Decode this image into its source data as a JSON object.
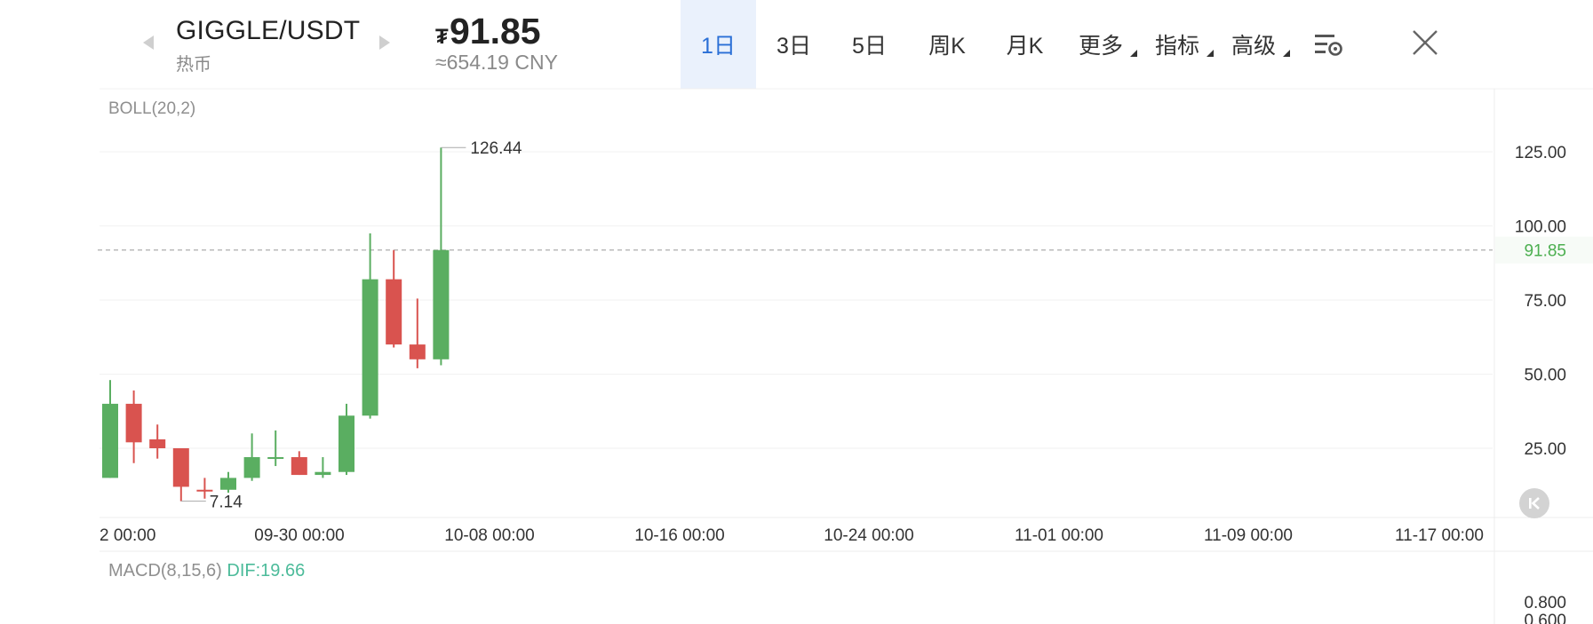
{
  "header": {
    "pair": "GIGGLE/USDT",
    "tag": "热币",
    "price_symbol": "₮",
    "price": "91.85",
    "price_cny": "≈654.19 CNY"
  },
  "tabs": [
    {
      "label": "1日",
      "active": true
    },
    {
      "label": "3日"
    },
    {
      "label": "5日"
    },
    {
      "label": "周K"
    },
    {
      "label": "月K"
    },
    {
      "label": "更多",
      "dropdown": true
    },
    {
      "label": "指标",
      "dropdown": true
    },
    {
      "label": "高级",
      "dropdown": true
    }
  ],
  "icons": {
    "settings": "chart-settings-icon",
    "close": "close-icon",
    "rewind": "rewind-to-latest-icon"
  },
  "colors": {
    "up": "#5aae61",
    "down": "#d9534f",
    "last_price": "#4caf50",
    "dif": "#4cbb9a",
    "active_tab": "#2a6fd6"
  },
  "indicator_label": "BOLL(20,2)",
  "macd": {
    "label": "MACD(8,15,6)",
    "dif": "DIF:19.66",
    "ticks": [
      "0.800",
      "0.600"
    ]
  },
  "chart_data": {
    "type": "candlestick",
    "interval": "1日",
    "ylim": [
      0,
      135
    ],
    "y_ticks": [
      "125.00",
      "100.00",
      "75.00",
      "50.00",
      "25.00"
    ],
    "y_tick_values": [
      125,
      100,
      75,
      50,
      25
    ],
    "x_tick_labels": [
      "2 00:00",
      "09-30 00:00",
      "10-08 00:00",
      "10-16 00:00",
      "10-24 00:00",
      "11-01 00:00",
      "11-09 00:00",
      "11-17 00:00"
    ],
    "last_price": 91.85,
    "last_price_label": "91.85",
    "max_label": "126.44",
    "min_label": "7.14",
    "candles": [
      {
        "open": 15,
        "high": 48,
        "low": 15,
        "close": 40
      },
      {
        "open": 40,
        "high": 44.5,
        "low": 20,
        "close": 27
      },
      {
        "open": 28,
        "high": 33,
        "low": 21.5,
        "close": 25
      },
      {
        "open": 25,
        "high": 25,
        "low": 7.14,
        "close": 12
      },
      {
        "open": 11,
        "high": 15,
        "low": 8,
        "close": 10.5
      },
      {
        "open": 11,
        "high": 17,
        "low": 10,
        "close": 15
      },
      {
        "open": 15,
        "high": 30,
        "low": 14,
        "close": 22
      },
      {
        "open": 22,
        "high": 31,
        "low": 19,
        "close": 22
      },
      {
        "open": 22,
        "high": 24,
        "low": 16,
        "close": 16
      },
      {
        "open": 16,
        "high": 22,
        "low": 15,
        "close": 17
      },
      {
        "open": 17,
        "high": 40,
        "low": 16,
        "close": 36
      },
      {
        "open": 36,
        "high": 97.5,
        "low": 35,
        "close": 82
      },
      {
        "open": 82,
        "high": 91.85,
        "low": 59,
        "close": 60
      },
      {
        "open": 60,
        "high": 75.5,
        "low": 52,
        "close": 55
      },
      {
        "open": 55,
        "high": 126.44,
        "low": 53,
        "close": 91.85
      }
    ]
  }
}
